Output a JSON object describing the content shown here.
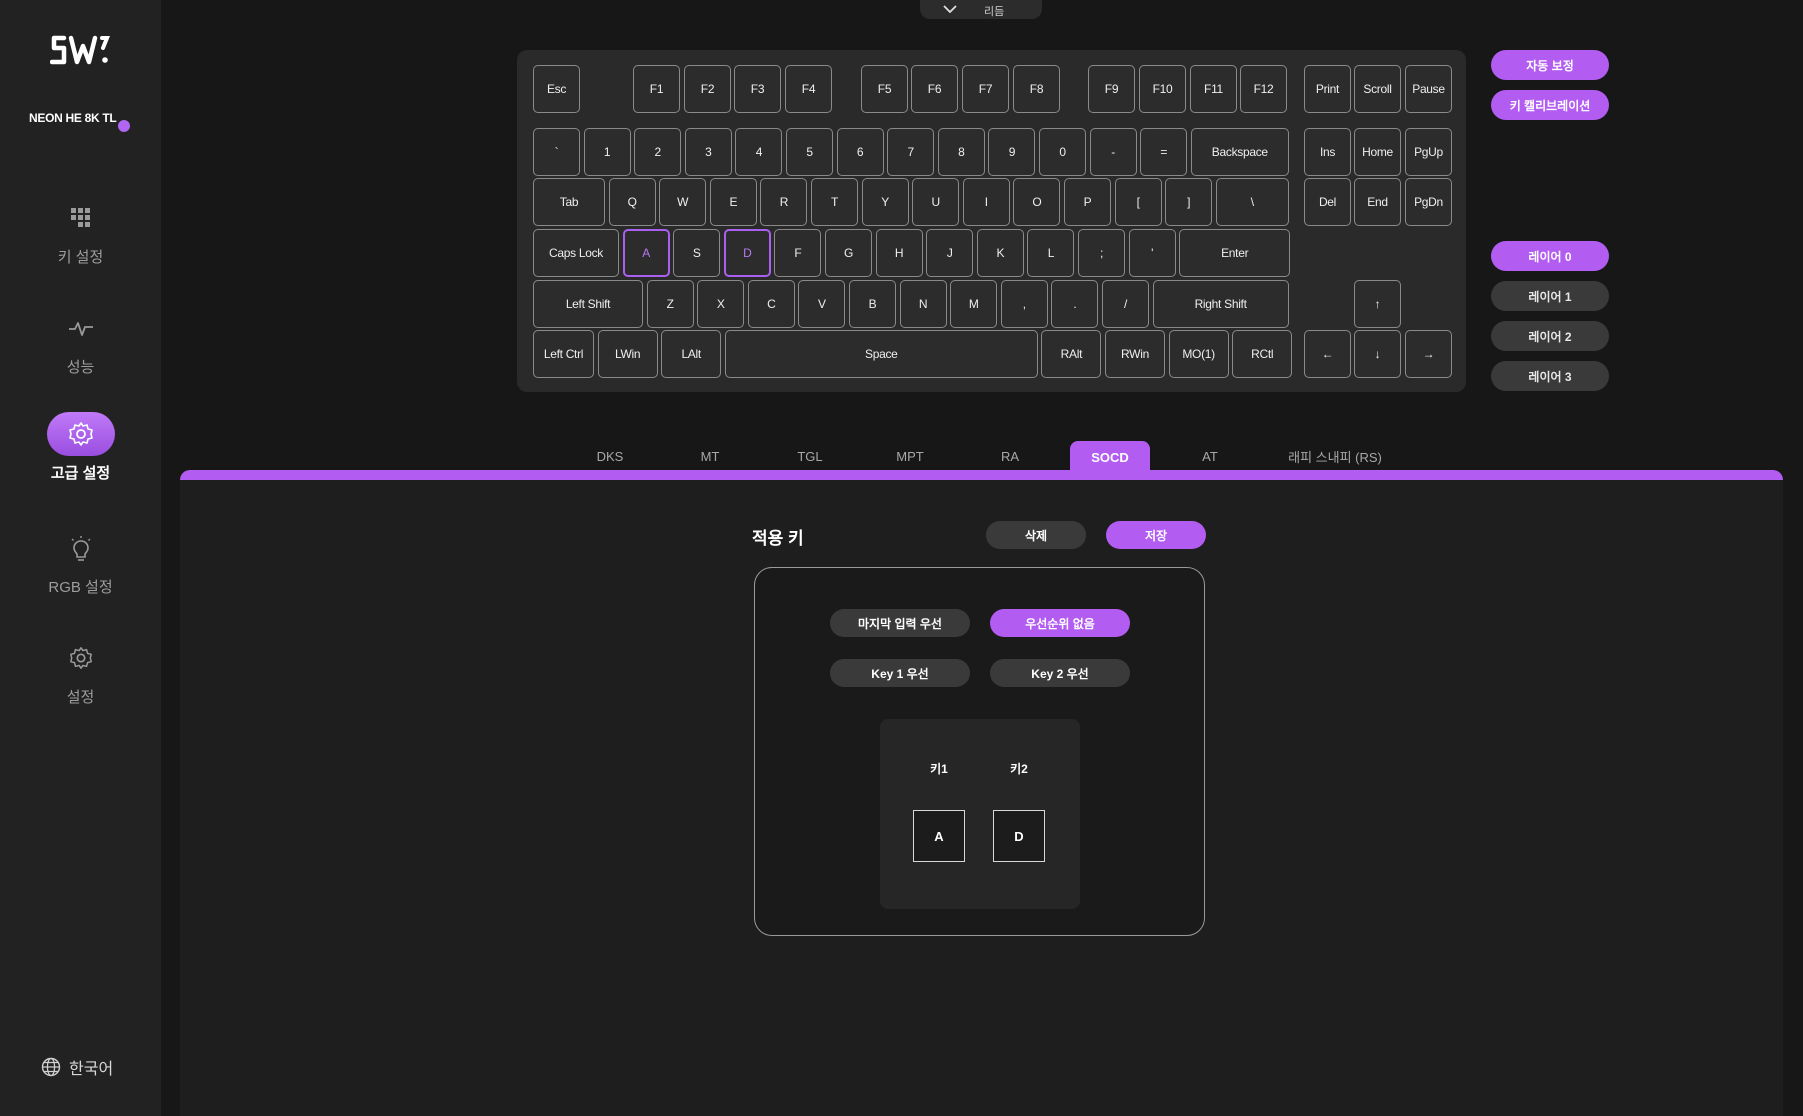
{
  "sidebar": {
    "device_name": "NEON HE 8K TL",
    "status_color": "#b066f0",
    "nav": [
      {
        "label": "키 설정",
        "icon": "keys-grid-icon"
      },
      {
        "label": "성능",
        "icon": "performance-pulse-icon"
      },
      {
        "label": "고급 설정",
        "icon": "advanced-gear-icon",
        "active": true
      },
      {
        "label": "RGB 설정",
        "icon": "lightbulb-icon"
      },
      {
        "label": "설정",
        "icon": "settings-gear-icon"
      }
    ],
    "language": "한국어"
  },
  "top_tab": {
    "label": "리듬"
  },
  "keyboard": {
    "selected_keys": [
      "A",
      "D"
    ],
    "rows": [
      [
        "Esc",
        "F1",
        "F2",
        "F3",
        "F4",
        "F5",
        "F6",
        "F7",
        "F8",
        "F9",
        "F10",
        "F11",
        "F12",
        "Print",
        "Scroll",
        "Pause"
      ],
      [
        "`",
        "1",
        "2",
        "3",
        "4",
        "5",
        "6",
        "7",
        "8",
        "9",
        "0",
        "-",
        "=",
        "Backspace",
        "Ins",
        "Home",
        "PgUp"
      ],
      [
        "Tab",
        "Q",
        "W",
        "E",
        "R",
        "T",
        "Y",
        "U",
        "I",
        "O",
        "P",
        "[",
        "]",
        "\\",
        "Del",
        "End",
        "PgDn"
      ],
      [
        "Caps Lock",
        "A",
        "S",
        "D",
        "F",
        "G",
        "H",
        "J",
        "K",
        "L",
        ";",
        "'",
        "Enter"
      ],
      [
        "Left Shift",
        "Z",
        "X",
        "C",
        "V",
        "B",
        "N",
        "M",
        ",",
        ".",
        "/",
        "Right Shift",
        "↑"
      ],
      [
        "Left Ctrl",
        "LWin",
        "LAlt",
        "Space",
        "RAlt",
        "RWin",
        "MO(1)",
        "RCtl",
        "←",
        "↓",
        "→"
      ]
    ]
  },
  "side_buttons": {
    "auto_calibrate": "자동 보정",
    "key_calibration": "키 캘리브레이션",
    "layers": [
      "레이어 0",
      "레이어 1",
      "레이어 2",
      "레이어 3"
    ],
    "active_layer": "레이어 0"
  },
  "feature_tabs": {
    "items": [
      "DKS",
      "MT",
      "TGL",
      "MPT",
      "RA",
      "SOCD",
      "AT",
      "래피 스내피 (RS)"
    ],
    "active": "SOCD"
  },
  "socd": {
    "heading": "적용 키",
    "delete_label": "삭제",
    "save_label": "저장",
    "modes": [
      "마지막 입력 우선",
      "우선순위 없음",
      "Key 1 우선",
      "Key 2 우선"
    ],
    "selected_mode": "우선순위 없음",
    "key1_label": "키1",
    "key2_label": "키2",
    "key1_value": "A",
    "key2_value": "D"
  },
  "colors": {
    "accent": "#b35cf2",
    "background": "#171717",
    "sidebar": "#222222"
  }
}
